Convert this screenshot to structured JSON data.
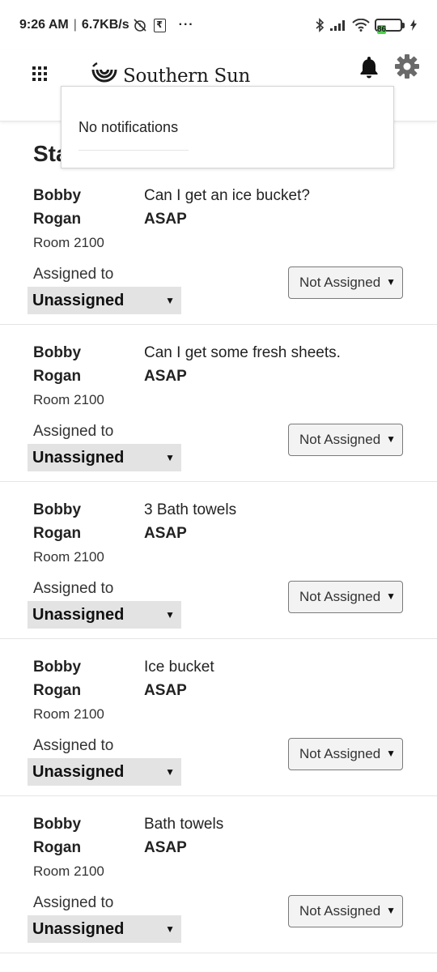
{
  "status_bar": {
    "time": "9:26 AM",
    "speed": "6.7KB/s",
    "battery": "86",
    "more": "···"
  },
  "header": {
    "brand": "Southern Sun"
  },
  "notifications": {
    "message": "No notifications"
  },
  "page": {
    "title": "Sta"
  },
  "requests": [
    {
      "first_name": "Bobby",
      "last_name": "Rogan",
      "room": "Room 2100",
      "request": "Can I get an ice bucket?",
      "priority": "ASAP",
      "assigned_label": "Assigned to",
      "assigned_value": "Unassigned",
      "status": "Not Assigned"
    },
    {
      "first_name": "Bobby",
      "last_name": "Rogan",
      "room": "Room 2100",
      "request": "Can I get some fresh sheets.",
      "priority": "ASAP",
      "assigned_label": "Assigned to",
      "assigned_value": "Unassigned",
      "status": "Not Assigned"
    },
    {
      "first_name": "Bobby",
      "last_name": "Rogan",
      "room": "Room 2100",
      "request": "3 Bath towels",
      "priority": "ASAP",
      "assigned_label": "Assigned to",
      "assigned_value": "Unassigned",
      "status": "Not Assigned"
    },
    {
      "first_name": "Bobby",
      "last_name": "Rogan",
      "room": "Room 2100",
      "request": "Ice bucket",
      "priority": "ASAP",
      "assigned_label": "Assigned to",
      "assigned_value": "Unassigned",
      "status": "Not Assigned"
    },
    {
      "first_name": "Bobby",
      "last_name": "Rogan",
      "room": "Room 2100",
      "request": "Bath towels",
      "priority": "ASAP",
      "assigned_label": "Assigned to",
      "assigned_value": "Unassigned",
      "status": "Not Assigned"
    }
  ],
  "icons": {
    "menu": "grid-menu-icon",
    "logo": "southern-sun-logo-icon",
    "bell": "bell-icon",
    "settings": "gear-icon",
    "dropdown": "caret-down-icon"
  },
  "colors": {
    "battery_fill": "#4cd34a",
    "select_bg": "#e3e3e3",
    "status_btn_bg": "#f3f3f3"
  }
}
